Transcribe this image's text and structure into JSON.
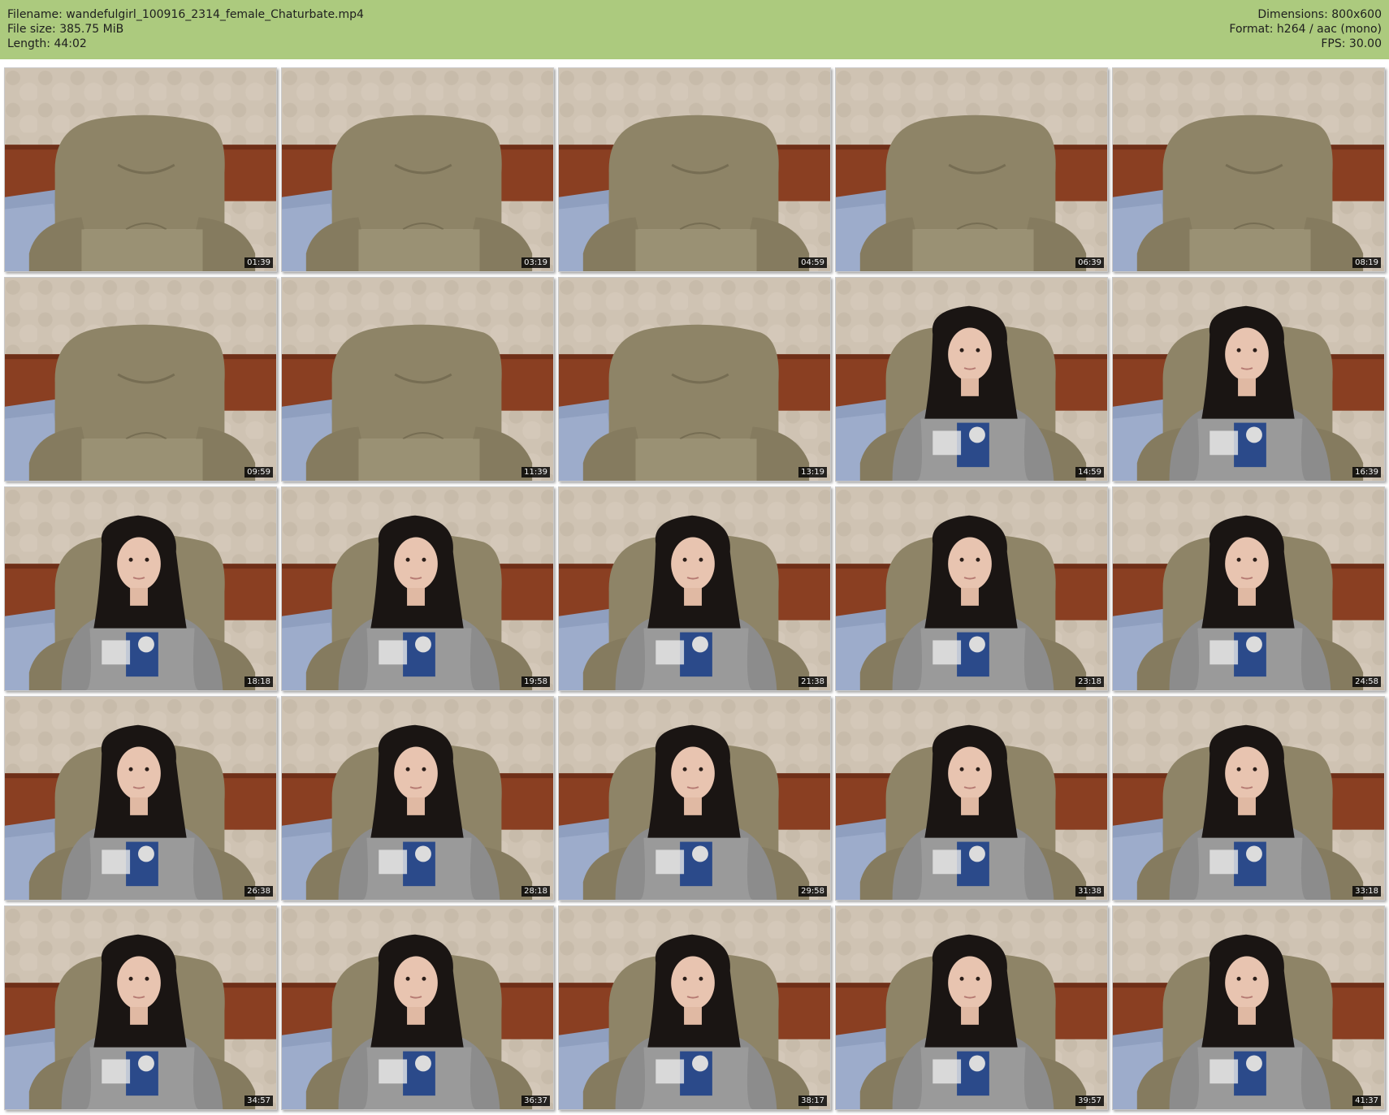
{
  "header": {
    "filename_label": "Filename: wandefulgirl_100916_2314_female_Chaturbate.mp4",
    "filesize_label": "File size: 385.75 MiB",
    "length_label": "Length: 44:02",
    "dimensions_label": "Dimensions: 800x600",
    "format_label": "Format: h264 / aac (mono)",
    "fps_label": "FPS: 30.00",
    "background_color": "#acca7e"
  },
  "thumbnails": [
    {
      "timestamp": "01:39",
      "scene": "empty-chair"
    },
    {
      "timestamp": "03:19",
      "scene": "empty-chair"
    },
    {
      "timestamp": "04:59",
      "scene": "empty-chair"
    },
    {
      "timestamp": "06:39",
      "scene": "empty-chair"
    },
    {
      "timestamp": "08:19",
      "scene": "empty-chair"
    },
    {
      "timestamp": "09:59",
      "scene": "empty-chair"
    },
    {
      "timestamp": "11:39",
      "scene": "empty-chair"
    },
    {
      "timestamp": "13:19",
      "scene": "empty-chair"
    },
    {
      "timestamp": "14:59",
      "scene": "person-seated"
    },
    {
      "timestamp": "16:39",
      "scene": "person-seated"
    },
    {
      "timestamp": "18:18",
      "scene": "person-seated"
    },
    {
      "timestamp": "19:58",
      "scene": "person-seated"
    },
    {
      "timestamp": "21:38",
      "scene": "person-seated"
    },
    {
      "timestamp": "23:18",
      "scene": "person-seated"
    },
    {
      "timestamp": "24:58",
      "scene": "person-seated"
    },
    {
      "timestamp": "26:38",
      "scene": "person-seated"
    },
    {
      "timestamp": "28:18",
      "scene": "person-seated"
    },
    {
      "timestamp": "29:58",
      "scene": "person-seated"
    },
    {
      "timestamp": "31:38",
      "scene": "person-seated"
    },
    {
      "timestamp": "33:18",
      "scene": "person-seated"
    },
    {
      "timestamp": "34:57",
      "scene": "person-seated"
    },
    {
      "timestamp": "36:37",
      "scene": "person-seated"
    },
    {
      "timestamp": "38:17",
      "scene": "person-seated"
    },
    {
      "timestamp": "39:57",
      "scene": "person-seated"
    },
    {
      "timestamp": "41:37",
      "scene": "person-seated"
    }
  ]
}
